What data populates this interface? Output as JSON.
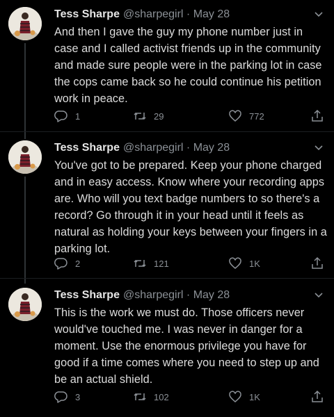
{
  "author": {
    "name": "Tess Sharpe",
    "handle": "@sharpegirl",
    "separator": "·"
  },
  "tweets": [
    {
      "date": "May 28",
      "text": "And then I gave the guy my phone number just in case and I called activist friends up in the community and made sure people were in the parking lot in case the cops came back so he could continue his petition work in peace.",
      "replies": "1",
      "retweets": "29",
      "likes": "772"
    },
    {
      "date": "May 28",
      "text": "You've got to be prepared. Keep your phone charged and in easy access. Know where your recording apps are. Who will you text badge numbers to so there's a record? Go through it in your head until it feels as natural as holding your keys between your fingers in a parking lot.",
      "replies": "2",
      "retweets": "121",
      "likes": "1K"
    },
    {
      "date": "May 28",
      "text": "This is the work we must do. Those officers never would've touched me. I was never in danger for a moment. Use the enormous privilege you have for good if a time comes where you need to step up and be an actual shield.",
      "replies": "3",
      "retweets": "102",
      "likes": "1K"
    }
  ],
  "icons": {
    "reply": "reply-icon",
    "retweet": "retweet-icon",
    "like": "heart-icon",
    "share": "share-icon",
    "menu": "chevron-down-icon"
  },
  "colors": {
    "background": "#000000",
    "text": "#dcdcdc",
    "secondary": "#8b9096",
    "thread_line": "#2f3336"
  }
}
